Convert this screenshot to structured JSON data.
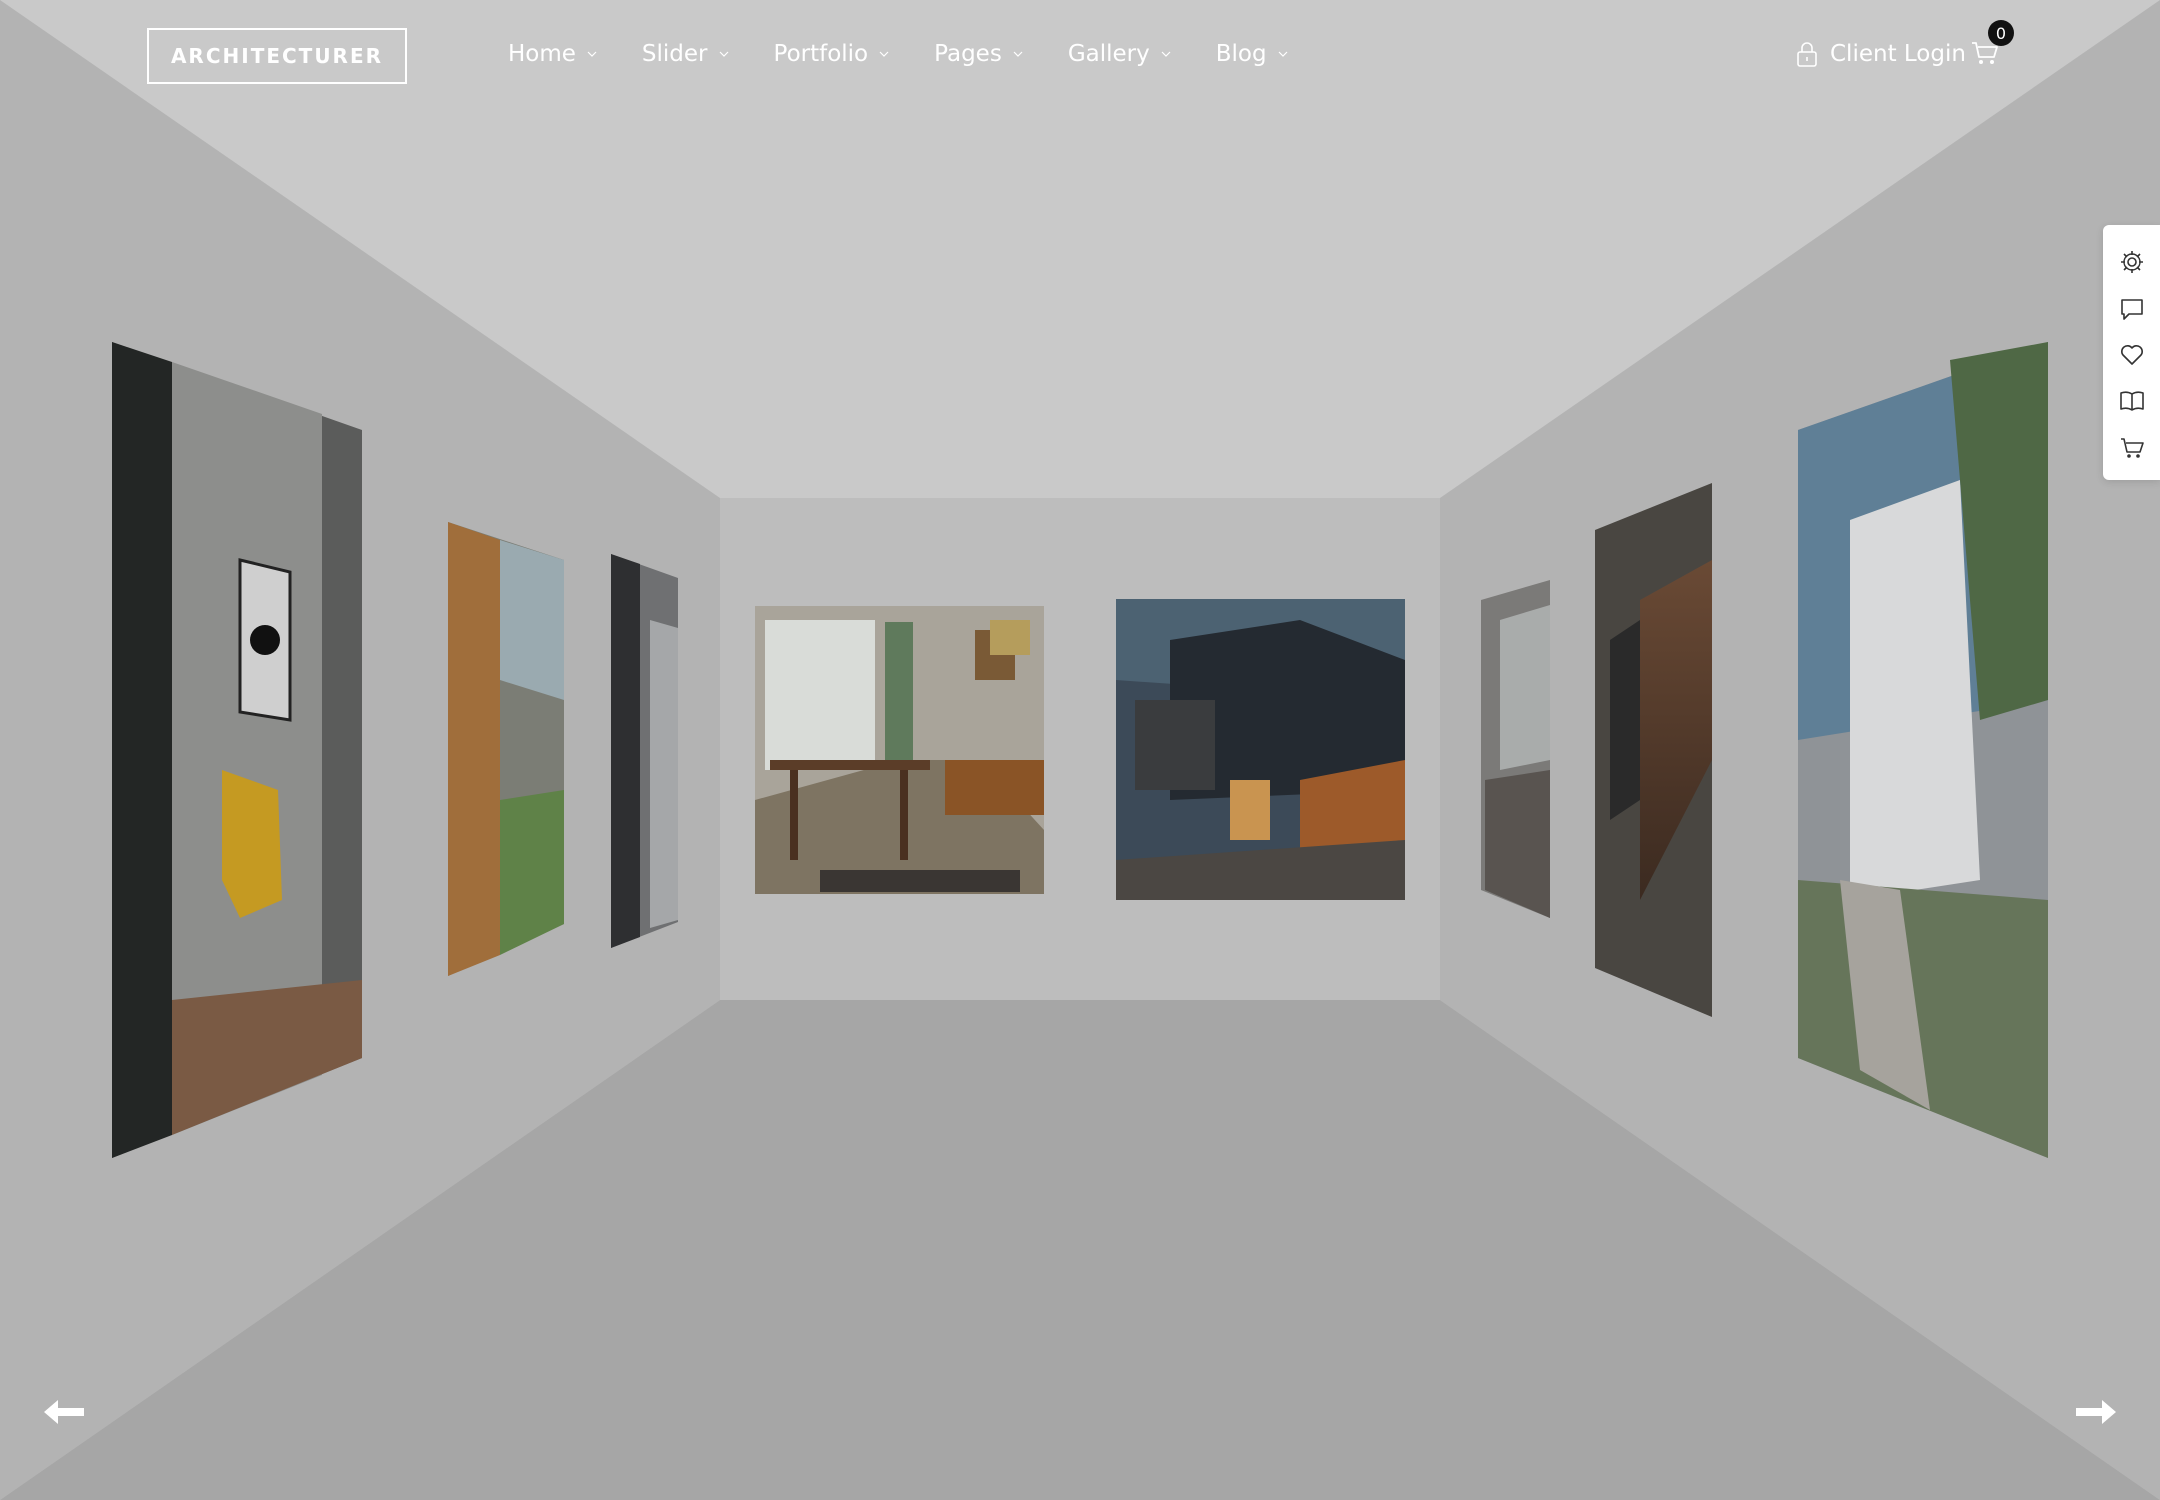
{
  "brand": {
    "logo_text": "ARCHITECTURER"
  },
  "nav": {
    "items": [
      {
        "label": "Home"
      },
      {
        "label": "Slider"
      },
      {
        "label": "Portfolio"
      },
      {
        "label": "Pages"
      },
      {
        "label": "Gallery"
      },
      {
        "label": "Blog"
      }
    ]
  },
  "header": {
    "login_label": "Client Login",
    "cart_count": "0"
  },
  "side_toolbar": {
    "icons": [
      "gear-icon",
      "comment-icon",
      "heart-icon",
      "book-icon",
      "cart-icon"
    ]
  },
  "slider": {
    "prev_icon": "arrow-left-icon",
    "next_icon": "arrow-right-icon"
  },
  "colors": {
    "ceiling": "#c9c9c9",
    "walls": "#b3b3b3",
    "back_wall": "#bdbdbd",
    "floor": "#a6a6a6",
    "text": "#ffffff"
  }
}
